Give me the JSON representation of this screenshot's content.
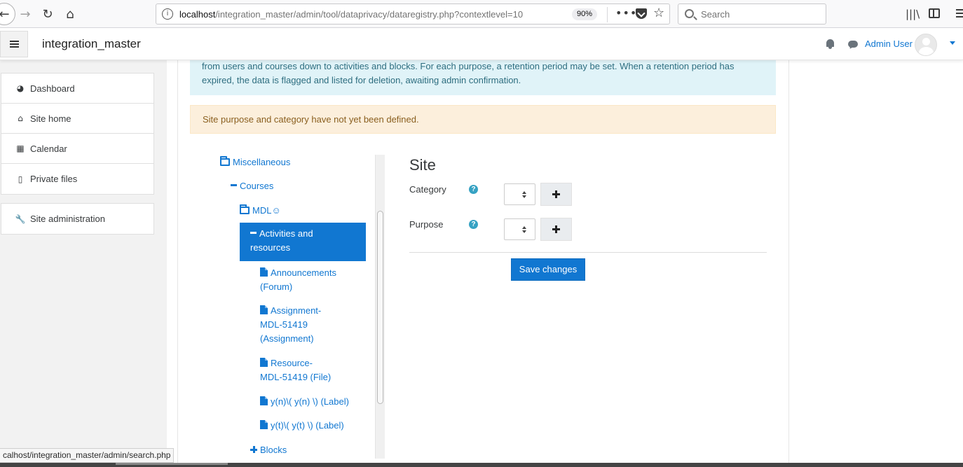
{
  "browser": {
    "url_host": "localhost",
    "url_path": "/integration_master/admin/tool/dataprivacy/dataregistry.php?contextlevel=10",
    "zoom": "90%",
    "search_placeholder": "Search"
  },
  "navbar": {
    "brand": "integration_master",
    "user_name": "Admin User"
  },
  "drawer": {
    "items": [
      {
        "label": "Dashboard",
        "icon": "dashboard-icon"
      },
      {
        "label": "Site home",
        "icon": "home-icon"
      },
      {
        "label": "Calendar",
        "icon": "calendar-icon"
      },
      {
        "label": "Private files",
        "icon": "file-icon"
      }
    ],
    "admin": {
      "label": "Site administration",
      "icon": "wrench-icon"
    }
  },
  "alerts": {
    "info_line1": "from users and courses down to activities and blocks. For each purpose, a retention period may be set. When a retention period has",
    "info_line2": "expired, the data is flagged and listed for deletion, awaiting admin confirmation.",
    "warning": "Site purpose and category have not yet been defined."
  },
  "tree": {
    "miscellaneous": "Miscellaneous",
    "courses": "Courses",
    "mdl": "MDL☺",
    "activities_line1": "Activities and",
    "activities_line2": "resources",
    "announcements_line1": "Announcements",
    "announcements_line2": "(Forum)",
    "assignment_line1": "Assignment-",
    "assignment_line2": "MDL-51419",
    "assignment_line3": "(Assignment)",
    "resource_line1": "Resource-",
    "resource_line2": "MDL-51419 (File)",
    "label1": "y(n)\\( y(n) \\) (Label)",
    "label2": "y(t)\\( y(t) \\) (Label)",
    "blocks": "Blocks"
  },
  "form": {
    "title": "Site",
    "category_label": "Category",
    "purpose_label": "Purpose",
    "save_label": "Save changes",
    "help_glyph": "?"
  },
  "status_bar": "calhost/integration_master/admin/search.php",
  "colors": {
    "link": "#1177d1",
    "info_bg": "#e0f3f8",
    "warning_bg": "#fcefdc"
  }
}
